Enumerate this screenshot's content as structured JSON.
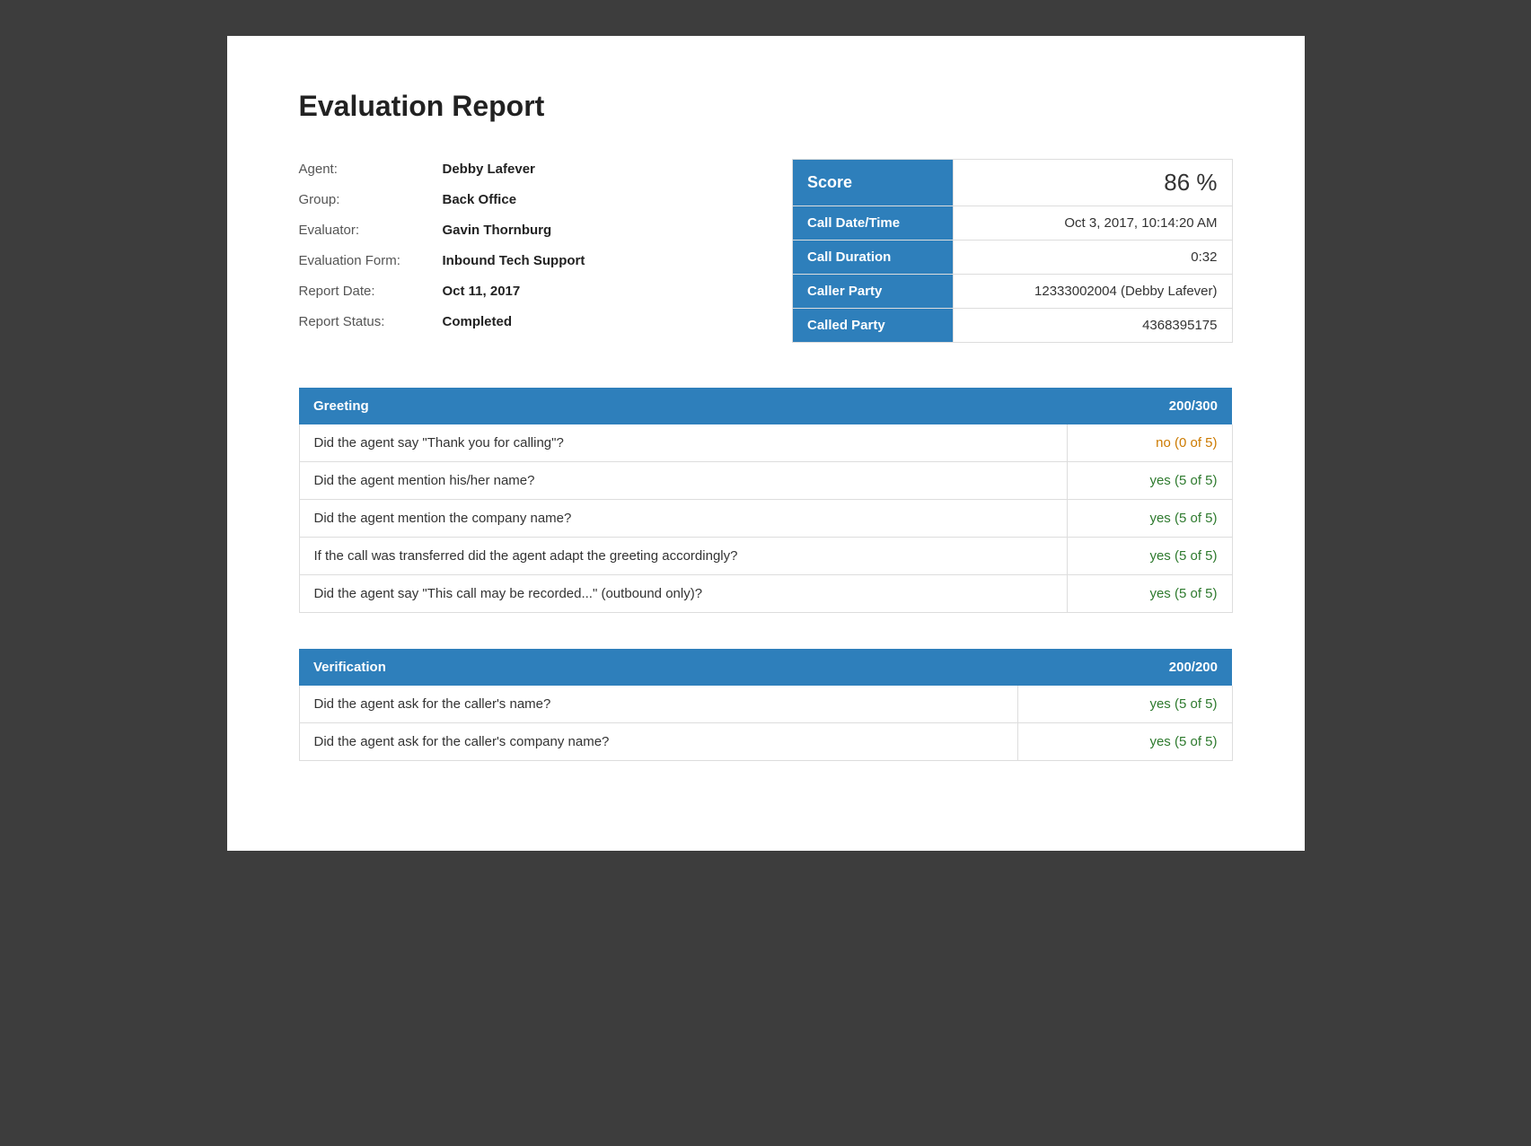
{
  "page": {
    "title": "Evaluation Report"
  },
  "agent_info": {
    "agent_label": "Agent:",
    "agent_value": "Debby Lafever",
    "group_label": "Group:",
    "group_value": "Back Office",
    "evaluator_label": "Evaluator:",
    "evaluator_value": "Gavin Thornburg",
    "form_label": "Evaluation Form:",
    "form_value": "Inbound Tech Support",
    "report_date_label": "Report Date:",
    "report_date_value": "Oct 11, 2017",
    "report_status_label": "Report Status:",
    "report_status_value": "Completed"
  },
  "score_table": {
    "score_label": "Score",
    "score_value": "86 %",
    "call_datetime_label": "Call Date/Time",
    "call_datetime_value": "Oct 3, 2017, 10:14:20 AM",
    "call_duration_label": "Call Duration",
    "call_duration_value": "0:32",
    "caller_party_label": "Caller Party",
    "caller_party_value": "12333002004 (Debby Lafever)",
    "called_party_label": "Called Party",
    "called_party_value": "4368395175"
  },
  "greeting_section": {
    "header_label": "Greeting",
    "header_score": "200/300",
    "questions": [
      {
        "question": "Did the agent say \"Thank you for calling\"?",
        "answer": "no (0 of 5)",
        "answer_type": "no"
      },
      {
        "question": "Did the agent mention his/her name?",
        "answer": "yes (5 of 5)",
        "answer_type": "yes"
      },
      {
        "question": "Did the agent mention the company name?",
        "answer": "yes (5 of 5)",
        "answer_type": "yes"
      },
      {
        "question": "If the call was transferred did the agent adapt the greeting accordingly?",
        "answer": "yes (5 of 5)",
        "answer_type": "yes"
      },
      {
        "question": "Did the agent say \"This call may be recorded...\" (outbound only)?",
        "answer": "yes (5 of 5)",
        "answer_type": "yes"
      }
    ]
  },
  "verification_section": {
    "header_label": "Verification",
    "header_score": "200/200",
    "questions": [
      {
        "question": "Did the agent ask for the caller's name?",
        "answer": "yes (5 of 5)",
        "answer_type": "yes"
      },
      {
        "question": "Did the agent ask for the caller's company name?",
        "answer": "yes (5 of 5)",
        "answer_type": "yes"
      }
    ]
  }
}
